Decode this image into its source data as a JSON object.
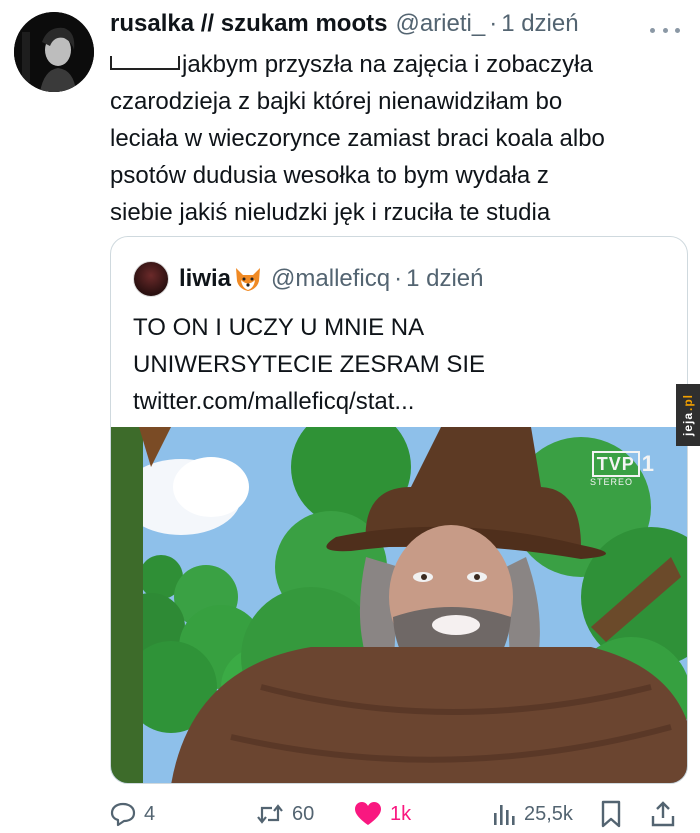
{
  "tweet": {
    "display_name": "rusalka // szukam moots",
    "handle": "@arieti_",
    "separator": "·",
    "time": "1 dzień",
    "text_lines": [
      "jakbym przyszła na zajęcia i zobaczyła",
      "czarodzieja z bajki której nienawidziłam bo",
      "leciała w wieczorynce zamiast braci koala albo",
      "psotów dudusia wesołka to bym wydała z",
      "siebie jakiś nieludzki jęk i rzuciła te studia"
    ]
  },
  "quote": {
    "name": "liwia",
    "name_emoji": "fox-emoji",
    "handle": "@malleficq",
    "separator": "·",
    "time": "1 dzień",
    "text_lines": [
      "TO ON I UCZY U MNIE NA",
      "UNIWERSYTECIE ZESRAM SIE",
      "twitter.com/malleficq/stat..."
    ],
    "media": {
      "channel_logo": "TVP",
      "channel_number": "1",
      "channel_sub": "STEREO"
    }
  },
  "actions": {
    "replies": "4",
    "retweets": "60",
    "likes": "1k",
    "views": "25,5k"
  },
  "watermark": {
    "text": "jeja",
    "suffix": ".pl"
  },
  "colors": {
    "text_primary": "#0f1419",
    "text_secondary": "#536471",
    "like_pink": "#f91880",
    "border": "#cfd9de"
  }
}
